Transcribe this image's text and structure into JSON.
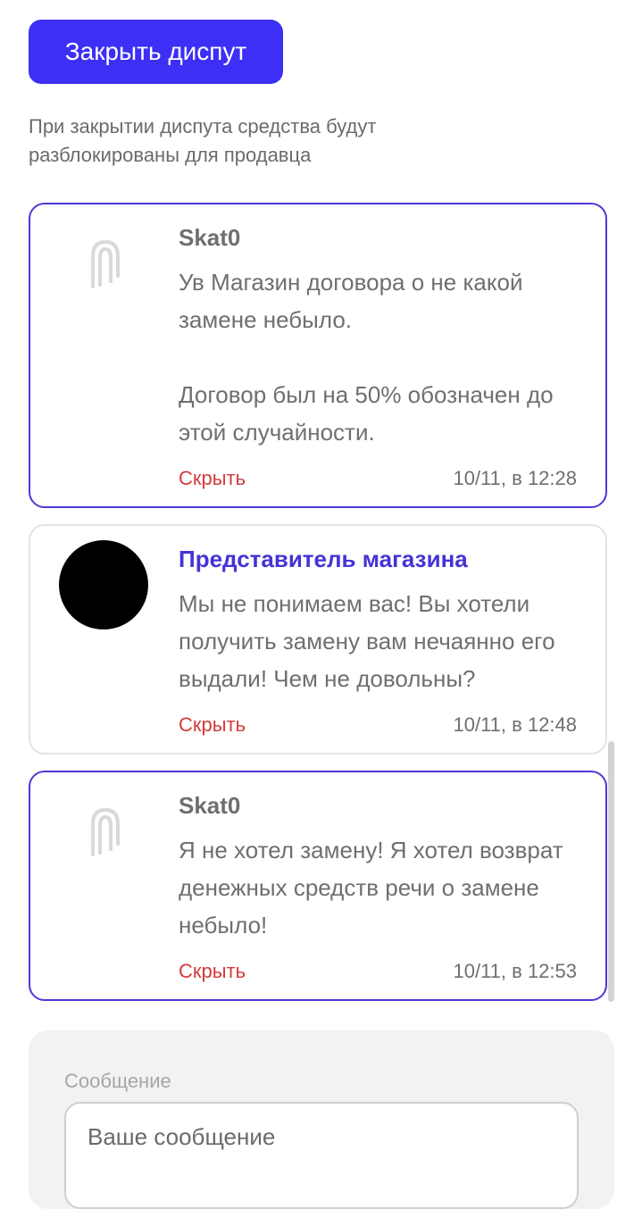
{
  "close_button": {
    "label": "Закрыть диспут"
  },
  "close_note": "При закрытии диспута средства будут разблокированы для продавца",
  "messages": [
    {
      "author": "Skat0",
      "avatar": "brand-logo-icon",
      "text": "Ув Магазин договора о не какой замене небыло.\n\nДоговор был на 50% обозначен до этой случайности.",
      "hide_label": "Скрыть",
      "time": "10/11, в 12:28"
    },
    {
      "author": "Представитель магазина",
      "avatar": "shop-avatar",
      "text": "Мы не понимаем вас! Вы хотели получить замену вам нечаянно его выдали! Чем не довольны?",
      "hide_label": "Скрыть",
      "time": "10/11, в 12:48"
    },
    {
      "author": "Skat0",
      "avatar": "brand-logo-icon",
      "text": "Я не хотел замену! Я хотел возврат денежных средств речи о замене небыло!",
      "hide_label": "Скрыть",
      "time": "10/11, в 12:53"
    }
  ],
  "composer": {
    "label": "Сообщение",
    "placeholder": "Ваше сообщение"
  },
  "colors": {
    "accent": "#3d2ff5",
    "own_border": "#4a3ad6",
    "hide": "#d23b3b",
    "shop_author": "#4433d6"
  }
}
